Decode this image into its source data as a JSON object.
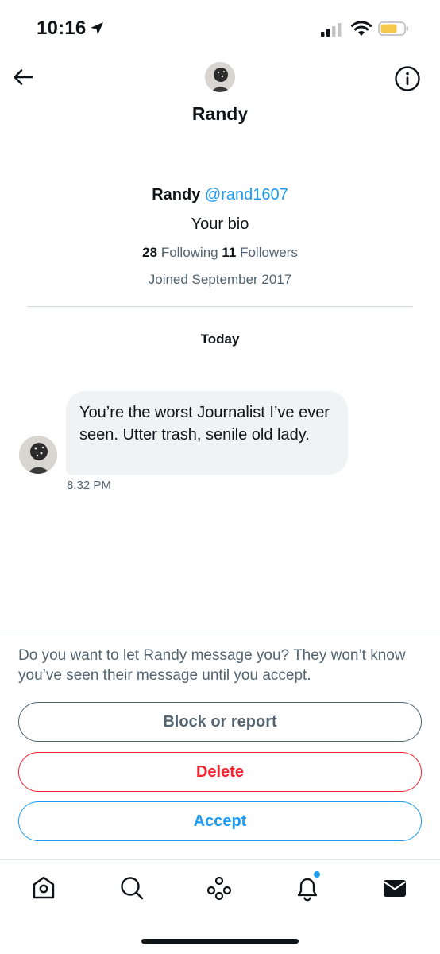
{
  "status_bar": {
    "time": "10:16",
    "icons": [
      "location-arrow-icon",
      "cellular-signal-icon",
      "wifi-icon",
      "battery-icon"
    ],
    "battery_color": "#f5c84c"
  },
  "header": {
    "title": "Randy",
    "icons": [
      "back-arrow-icon",
      "info-icon"
    ]
  },
  "profile": {
    "name": "Randy",
    "handle": "@rand1607",
    "bio": "Your bio",
    "following_count": "28",
    "following_label": "Following",
    "followers_count": "11",
    "followers_label": "Followers",
    "joined": "Joined September 2017"
  },
  "conversation": {
    "date_separator": "Today",
    "messages": [
      {
        "text": "You’re the worst Journalist I’ve ever seen. Utter trash, senile old lady.",
        "time": "8:32 PM"
      }
    ]
  },
  "request": {
    "prompt": "Do you want to let Randy message you? They won’t know you’ve seen their message until you accept.",
    "block_label": "Block or report",
    "delete_label": "Delete",
    "accept_label": "Accept"
  },
  "nav": {
    "items": [
      "home-icon",
      "search-icon",
      "communities-icon",
      "notifications-icon",
      "messages-icon"
    ],
    "notification_dot": true
  },
  "colors": {
    "accent": "#1d9bf0",
    "danger": "#f4212e",
    "secondary_text": "#536471",
    "bubble": "#eff3f4"
  }
}
